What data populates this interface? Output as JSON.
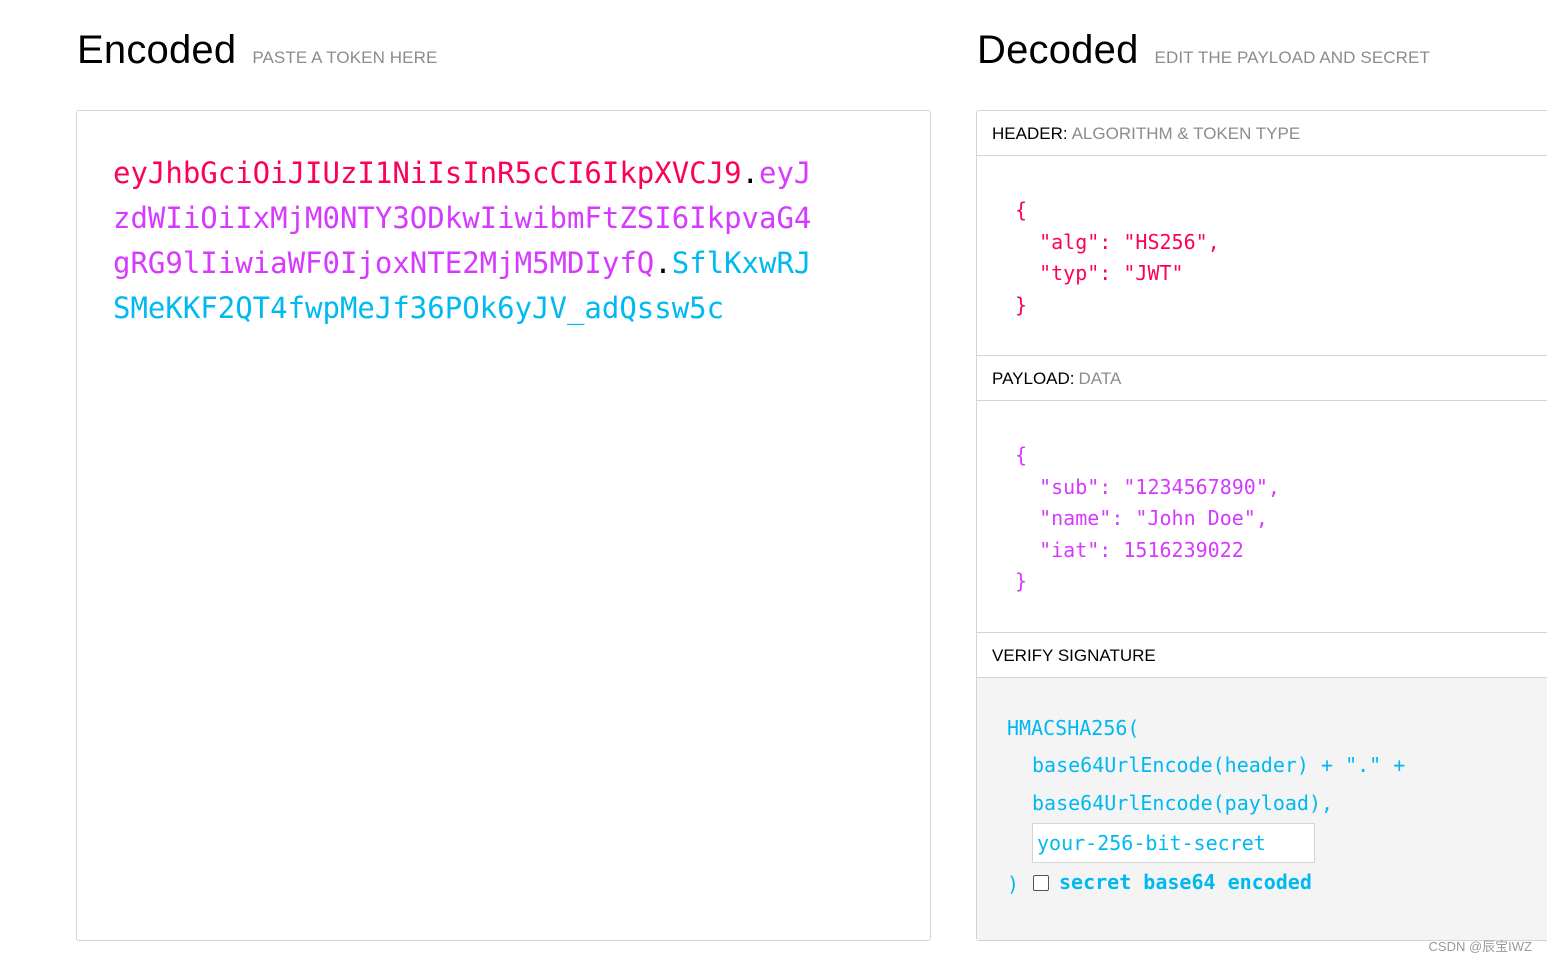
{
  "encoded": {
    "title": "Encoded",
    "subtitle": "PASTE A TOKEN HERE",
    "token_header": "eyJhbGciOiJIUzI1NiIsInR5cCI6IkpXVCJ9",
    "token_payload": "eyJzdWIiOiIxMjM0NTY3ODkwIiwibmFtZSI6IkpvaG4gRG9lIiwiaWF0IjoxNTE2MjM5MDIyfQ",
    "token_signature": "SflKxwRJSMeKKF2QT4fwpMeJf36POk6yJV_adQssw5c",
    "dot": "."
  },
  "decoded": {
    "title": "Decoded",
    "subtitle": "EDIT THE PAYLOAD AND SECRET",
    "header_section": {
      "label": "HEADER:",
      "sublabel": "ALGORITHM & TOKEN TYPE",
      "lines": [
        "{",
        "  \"alg\": \"HS256\",",
        "  \"typ\": \"JWT\"",
        "}"
      ]
    },
    "payload_section": {
      "label": "PAYLOAD:",
      "sublabel": "DATA",
      "lines": [
        "{",
        "  \"sub\": \"1234567890\",",
        "  \"name\": \"John Doe\",",
        "  \"iat\": 1516239022",
        "}"
      ]
    },
    "verify_section": {
      "label": "VERIFY SIGNATURE",
      "func": "HMACSHA256(",
      "arg1": "base64UrlEncode(header) + \".\" +",
      "arg2": "base64UrlEncode(payload),",
      "secret_placeholder": "your-256-bit-secret",
      "close": ")",
      "checkbox_label": "secret base64 encoded",
      "checkbox_checked": false
    }
  },
  "watermark": "CSDN @辰宝IWZ",
  "colors": {
    "header": "#fb015b",
    "payload": "#d63aff",
    "signature": "#00b9f1"
  }
}
